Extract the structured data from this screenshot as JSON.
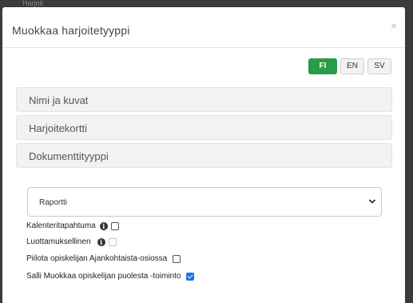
{
  "backdrop": {
    "text": "Harjoit"
  },
  "modal": {
    "title": "Muokkaa harjoitetyyppi",
    "close_symbol": "×"
  },
  "languages": [
    {
      "label": "FI",
      "active": true
    },
    {
      "label": "EN",
      "active": false
    },
    {
      "label": "SV",
      "active": false
    }
  ],
  "accordion": [
    {
      "label": "Nimi ja kuvat"
    },
    {
      "label": "Harjoitekortti"
    },
    {
      "label": "Dokumenttityyppi"
    }
  ],
  "document_type_select": {
    "selected": "Raportti"
  },
  "options": [
    {
      "label": "Kalenteritapahtuma",
      "has_info": true,
      "checked": false,
      "disabled": false
    },
    {
      "label": "Luottamuksellinen",
      "has_info": true,
      "checked": false,
      "disabled": true
    },
    {
      "label": "Piilota opiskelijan Ajankohtaista-osiossa",
      "has_info": false,
      "checked": false,
      "disabled": false
    },
    {
      "label": "Salli Muokkaa opiskelijan puolesta -toiminto",
      "has_info": false,
      "checked": true,
      "disabled": false
    }
  ],
  "colors": {
    "accent_green": "#2b9a49",
    "checkbox_blue": "#1a73e8"
  }
}
